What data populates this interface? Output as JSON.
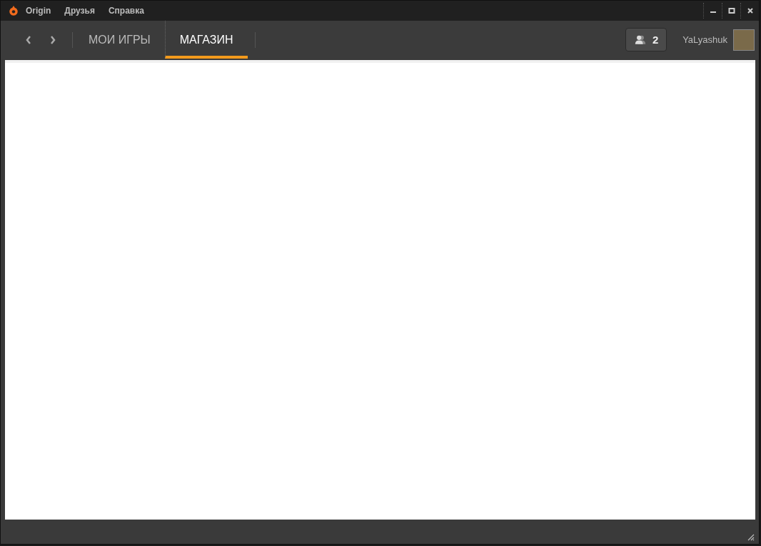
{
  "menu": [
    "Origin",
    "Друзья",
    "Справка"
  ],
  "tabs": [
    {
      "label": "МОИ ИГРЫ",
      "selected": false
    },
    {
      "label": "МАГАЗИН",
      "selected": true
    }
  ],
  "friends": {
    "count": "2"
  },
  "user": {
    "name": "YaLyashuk"
  }
}
